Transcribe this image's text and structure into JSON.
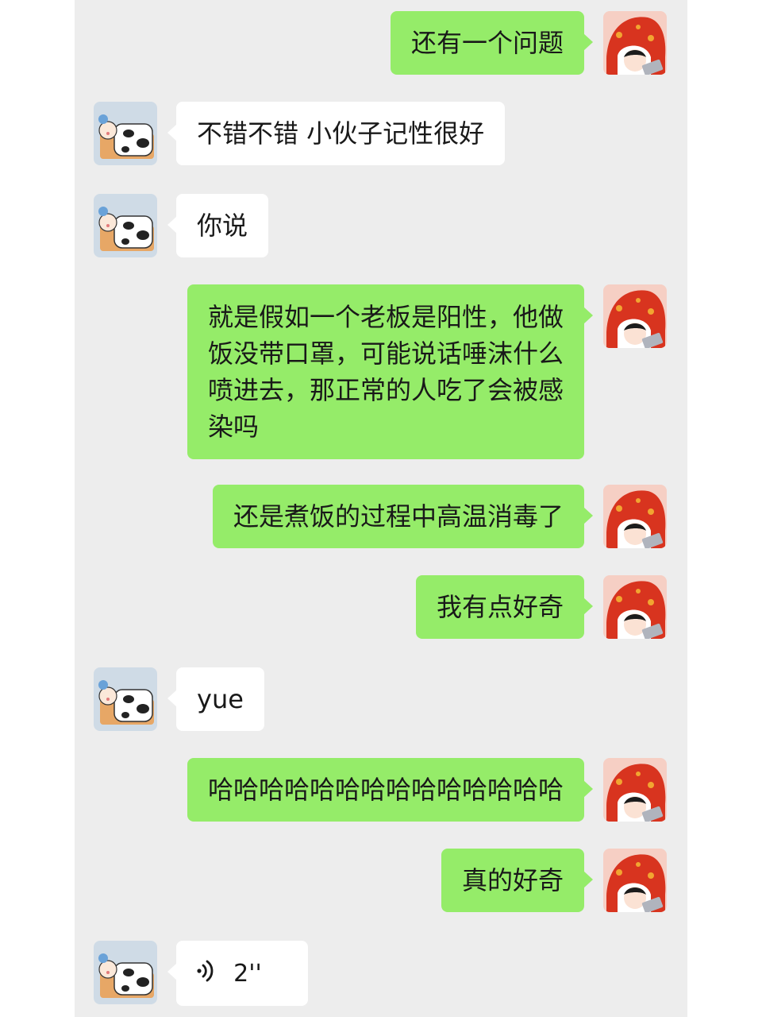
{
  "colors": {
    "chat_background": "#ededed",
    "outgoing_bubble": "#95ec69",
    "incoming_bubble": "#ffffff",
    "text": "#191919"
  },
  "avatars": {
    "self": "red-hooded-cartoon-girl-avatar",
    "contact": "cow-pattern-dog-cartoon-avatar"
  },
  "messages": [
    {
      "sender": "self",
      "type": "text",
      "text": "还有一个问题"
    },
    {
      "sender": "contact",
      "type": "text",
      "text": "不错不错 小伙子记性很好"
    },
    {
      "sender": "contact",
      "type": "text",
      "text": "你说"
    },
    {
      "sender": "self",
      "type": "text",
      "lines": [
        "就是假如一个老板是阳性，他做",
        "饭没带口罩，可能说话唾沫什么",
        "喷进去，那正常的人吃了会被感",
        "染吗"
      ]
    },
    {
      "sender": "self",
      "type": "text",
      "text": "还是煮饭的过程中高温消毒了"
    },
    {
      "sender": "self",
      "type": "text",
      "text": "我有点好奇"
    },
    {
      "sender": "contact",
      "type": "text",
      "text": "yue"
    },
    {
      "sender": "self",
      "type": "text",
      "text": "哈哈哈哈哈哈哈哈哈哈哈哈哈哈"
    },
    {
      "sender": "self",
      "type": "text",
      "text": "真的好奇"
    },
    {
      "sender": "contact",
      "type": "voice",
      "icon": "voice-wave-icon",
      "duration": "2''"
    }
  ]
}
